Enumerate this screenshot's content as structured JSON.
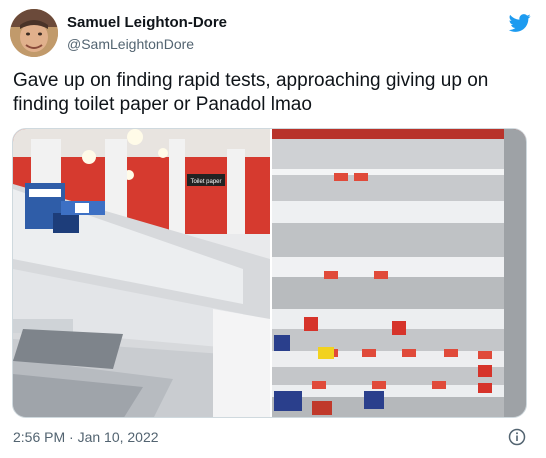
{
  "author": {
    "display_name": "Samuel Leighton-Dore",
    "handle": "@SamLeightonDore",
    "avatar_icon": "user-avatar-photo"
  },
  "brand": {
    "icon": "twitter-bird-icon",
    "color": "#1d9bf0"
  },
  "tweet": {
    "text": "Gave up on finding rapid tests, approaching giving up on finding toilet paper or Panadol lmao",
    "timestamp": "2:56 PM · Jan 10, 2022"
  },
  "media": {
    "left_photo": {
      "sign_text": "Toilet paper"
    },
    "right_photo": {}
  },
  "footer": {
    "info_icon": "info-icon"
  },
  "colors": {
    "text": "#0f1419",
    "muted": "#536471",
    "border": "#cfd9de"
  }
}
